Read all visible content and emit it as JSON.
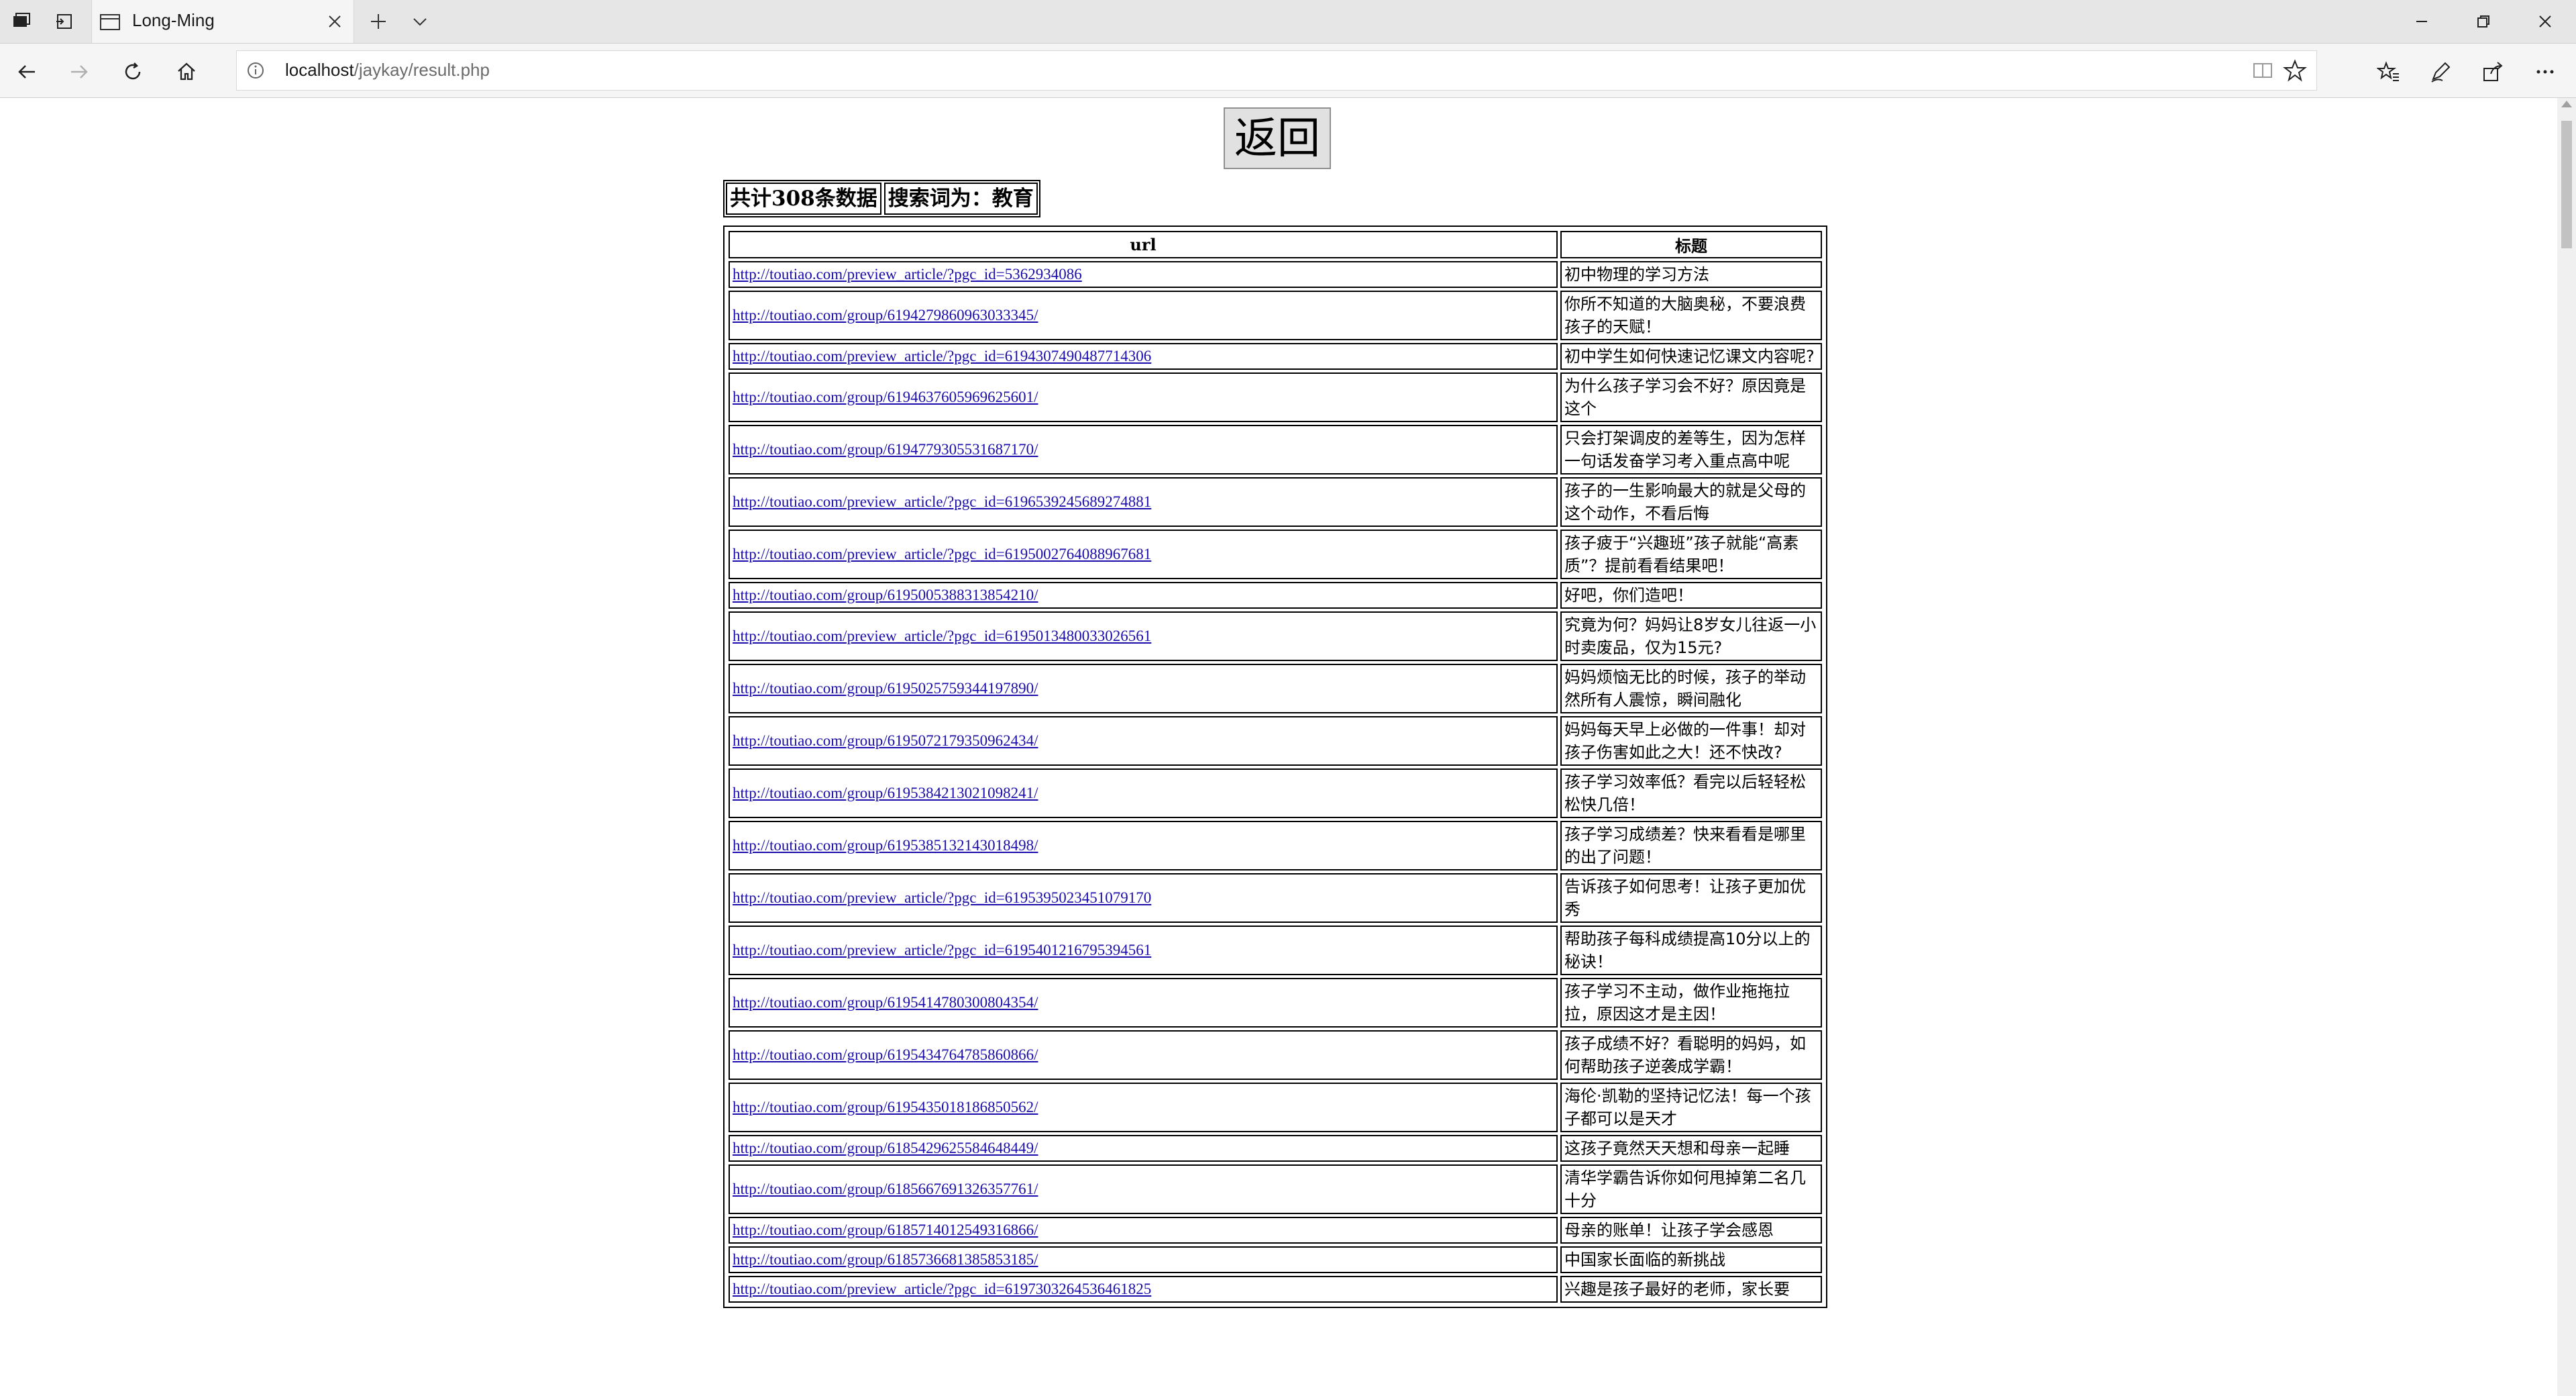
{
  "browser": {
    "tab_title": "Long-Ming",
    "url_host": "localhost",
    "url_path": "/jaykay/result.php"
  },
  "page": {
    "back_button": "返回",
    "summary_count": "共计308条数据",
    "summary_query": "搜索词为：教育",
    "table_headers": [
      "url",
      "标题"
    ],
    "rows": [
      {
        "url": "http://toutiao.com/preview_article/?pgc_id=5362934086",
        "title": "初中物理的学习方法"
      },
      {
        "url": "http://toutiao.com/group/6194279860963033345/",
        "title": "你所不知道的大脑奥秘，不要浪费孩子的天赋！"
      },
      {
        "url": "http://toutiao.com/preview_article/?pgc_id=6194307490487714306",
        "title": "初中学生如何快速记忆课文内容呢?"
      },
      {
        "url": "http://toutiao.com/group/6194637605969625601/",
        "title": "为什么孩子学习会不好？原因竟是这个"
      },
      {
        "url": "http://toutiao.com/group/6194779305531687170/",
        "title": "只会打架调皮的差等生，因为怎样一句话发奋学习考入重点高中呢"
      },
      {
        "url": "http://toutiao.com/preview_article/?pgc_id=6196539245689274881",
        "title": "孩子的一生影响最大的就是父母的这个动作，不看后悔"
      },
      {
        "url": "http://toutiao.com/preview_article/?pgc_id=6195002764088967681",
        "title": "孩子疲于“兴趣班”孩子就能“高素质”？提前看看结果吧！"
      },
      {
        "url": "http://toutiao.com/group/6195005388313854210/",
        "title": "好吧，你们造吧！"
      },
      {
        "url": "http://toutiao.com/preview_article/?pgc_id=6195013480033026561",
        "title": "究竟为何？妈妈让8岁女儿往返一小时卖废品，仅为15元?"
      },
      {
        "url": "http://toutiao.com/group/6195025759344197890/",
        "title": "妈妈烦恼无比的时候，孩子的举动然所有人震惊，瞬间融化"
      },
      {
        "url": "http://toutiao.com/group/6195072179350962434/",
        "title": "妈妈每天早上必做的一件事！却对孩子伤害如此之大！还不快改?"
      },
      {
        "url": "http://toutiao.com/group/6195384213021098241/",
        "title": "孩子学习效率低？看完以后轻轻松松快几倍！"
      },
      {
        "url": "http://toutiao.com/group/6195385132143018498/",
        "title": "孩子学习成绩差？快来看看是哪里的出了问题！"
      },
      {
        "url": "http://toutiao.com/preview_article/?pgc_id=6195395023451079170",
        "title": "告诉孩子如何思考！让孩子更加优秀"
      },
      {
        "url": "http://toutiao.com/preview_article/?pgc_id=6195401216795394561",
        "title": "帮助孩子每科成绩提高10分以上的秘诀！"
      },
      {
        "url": "http://toutiao.com/group/6195414780300804354/",
        "title": "孩子学习不主动，做作业拖拖拉拉，原因这才是主因！"
      },
      {
        "url": "http://toutiao.com/group/6195434764785860866/",
        "title": "孩子成绩不好？看聪明的妈妈，如何帮助孩子逆袭成学霸！"
      },
      {
        "url": "http://toutiao.com/group/6195435018186850562/",
        "title": "海伦·凯勒的坚持记忆法！每一个孩子都可以是天才"
      },
      {
        "url": "http://toutiao.com/group/6185429625584648449/",
        "title": "这孩子竟然天天想和母亲一起睡"
      },
      {
        "url": "http://toutiao.com/group/6185667691326357761/",
        "title": "清华学霸告诉你如何甩掉第二名几十分"
      },
      {
        "url": "http://toutiao.com/group/6185714012549316866/",
        "title": "母亲的账单！让孩子学会感恩"
      },
      {
        "url": "http://toutiao.com/group/6185736681385853185/",
        "title": "中国家长面临的新挑战"
      },
      {
        "url": "http://toutiao.com/preview_article/?pgc_id=6197303264536461825",
        "title": "兴趣是孩子最好的老师，家长要"
      }
    ]
  }
}
